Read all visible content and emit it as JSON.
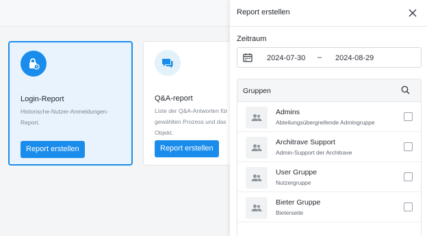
{
  "cards": [
    {
      "title": "Login-Report",
      "desc_lines": [
        "Historische-Nutzer-Anmeldungen-",
        "Report."
      ],
      "button": "Report erstellen"
    },
    {
      "title": "Q&A-report",
      "desc_lines": [
        "Liste der Q&A-Antworten für",
        "gewählten Prozess und das",
        "Objekt."
      ],
      "button": "Report erstellen"
    }
  ],
  "panel": {
    "title": "Report erstellen",
    "range_label": "Zeitraum",
    "date_from": "2024-07-30",
    "date_sep": "–",
    "date_to": "2024-08-29",
    "groups_title": "Gruppen",
    "groups": [
      {
        "name": "Admins",
        "desc": "Abteilungsübergreifende Admingruppe"
      },
      {
        "name": "Architrave Support",
        "desc": "Admin-Support der Architrave"
      },
      {
        "name": "User Gruppe",
        "desc": "Nutzergruppe"
      },
      {
        "name": "Bieter Gruppe",
        "desc": "Bieterseite"
      }
    ]
  },
  "colors": {
    "accent": "#1a8ceb",
    "selected_bg": "#e9f3fd"
  },
  "icons": {
    "card1": "lock-icon",
    "card2": "chat-icon",
    "close": "close-icon",
    "calendar": "calendar-icon",
    "search": "search-icon",
    "group": "group-icon"
  }
}
